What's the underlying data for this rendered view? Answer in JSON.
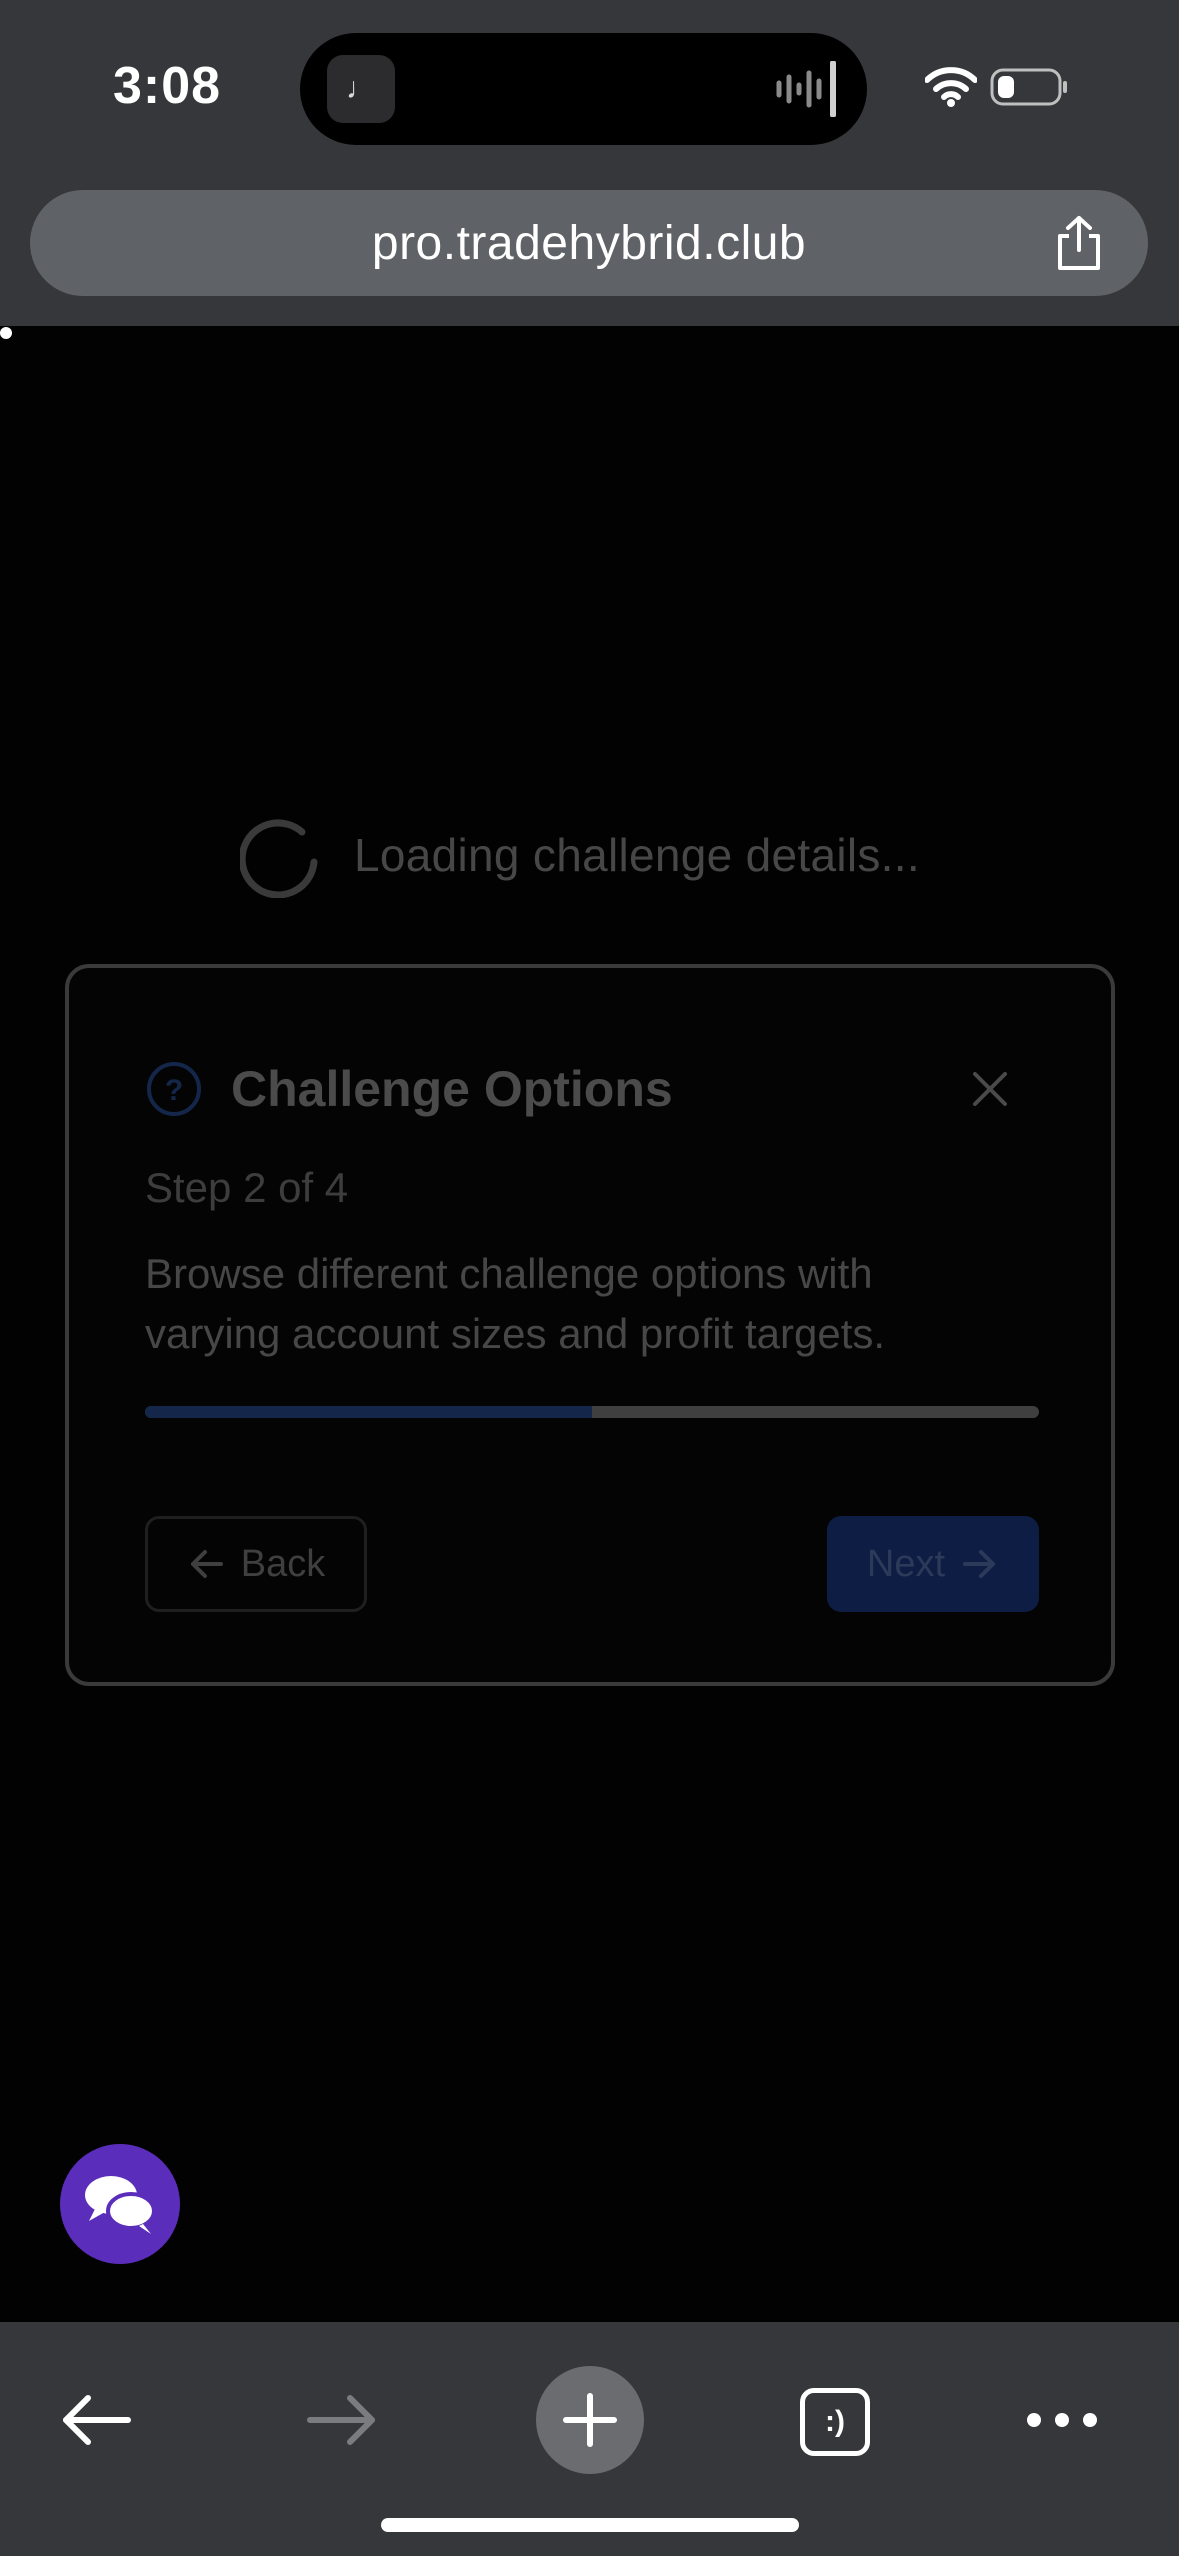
{
  "status_bar": {
    "time": "3:08",
    "island_app_glyph": "♩"
  },
  "browser": {
    "url": "pro.tradehybrid.club"
  },
  "loading": {
    "text": "Loading challenge details..."
  },
  "dialog": {
    "title": "Challenge Options",
    "step": "Step 2 of 4",
    "description": "Browse different challenge options with varying account sizes and profit targets.",
    "progress_fraction": 0.5,
    "back_label": "Back",
    "next_label": "Next"
  },
  "toolbar": {
    "tabs_label": ":)"
  },
  "colors": {
    "chrome": "#35373a",
    "progress_fill": "#14274b",
    "next_button": "#0d1d44",
    "chat_fab": "#5b2dbb"
  },
  "icons": [
    "wifi-icon",
    "battery-icon",
    "share-icon",
    "spinner-icon",
    "help-circle-icon",
    "close-icon",
    "arrow-left-icon",
    "arrow-right-icon",
    "chat-bubbles-icon",
    "back-arrow-icon",
    "forward-arrow-icon",
    "plus-icon",
    "tabs-icon",
    "more-icon"
  ]
}
